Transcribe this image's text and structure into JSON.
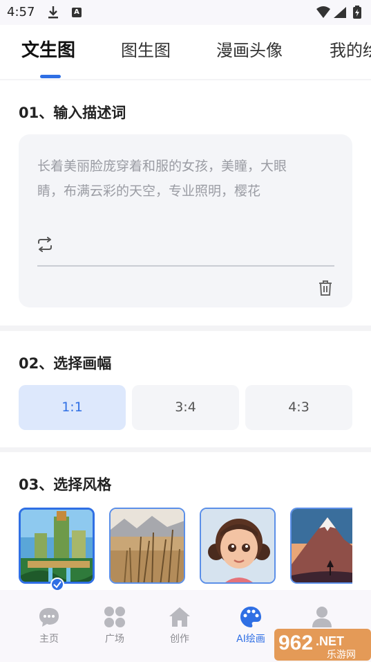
{
  "status_bar": {
    "time": "4:57",
    "notif_letter": "A"
  },
  "tabs": [
    {
      "label": "文生图",
      "active": true
    },
    {
      "label": "图生图",
      "active": false
    },
    {
      "label": "漫画头像",
      "active": false
    },
    {
      "label": "我的绘",
      "active": false
    }
  ],
  "section1": {
    "title": "01、输入描述词",
    "prompt_line1": "长着美丽脸庞穿着和服的女孩，美瞳，大眼",
    "prompt_line2": "睛，布满云彩的天空，专业照明，樱花"
  },
  "section2": {
    "title": "02、选择画幅",
    "ratios": [
      {
        "label": "1:1",
        "selected": true
      },
      {
        "label": "3:4",
        "selected": false
      },
      {
        "label": "4:3",
        "selected": false
      }
    ]
  },
  "section3": {
    "title": "03、选择风格",
    "styles": [
      {
        "icon": "fantasy-city-thumbnail",
        "selected": true
      },
      {
        "icon": "wheat-field-thumbnail",
        "selected": false
      },
      {
        "icon": "cartoon-girl-thumbnail",
        "selected": false
      },
      {
        "icon": "mountain-sunset-thumbnail",
        "selected": false
      }
    ]
  },
  "bottom_nav": [
    {
      "label": "主页",
      "icon": "chat-bubble-icon",
      "active": false
    },
    {
      "label": "广场",
      "icon": "grid-icon",
      "active": false
    },
    {
      "label": "创作",
      "icon": "home-icon",
      "active": false
    },
    {
      "label": "AI绘画",
      "icon": "palette-icon",
      "active": true
    },
    {
      "label": "我的",
      "icon": "person-icon",
      "active": false
    }
  ],
  "watermark": {
    "number": "962",
    "suffix": ".NET",
    "sub": "乐游网"
  },
  "colors": {
    "accent": "#2f6fe4",
    "selected_bg": "#dde8fc",
    "box_bg": "#f4f5f8"
  }
}
